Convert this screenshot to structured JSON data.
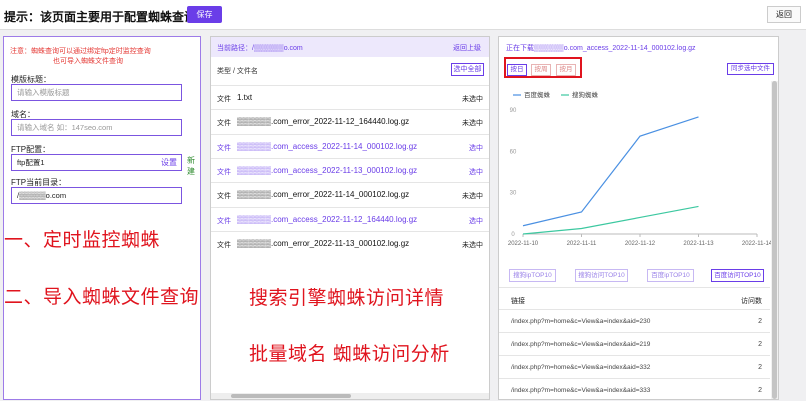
{
  "header": {
    "title": "提示：该页面主要用于配置蜘蛛查询",
    "save_label": "保存",
    "back_label": "返回"
  },
  "left": {
    "note_line1": "注意：蜘蛛查询可以通过绑定ftp定时监控查询",
    "note_line2": "也可导入蜘蛛文件查询",
    "template_label": "模版标题：",
    "template_placeholder": "请输入模版标题",
    "domain_label": "域名：",
    "domain_placeholder": "请输入域名 如：147seo.com",
    "ftp_label": "FTP配置：",
    "ftp_value": "ftp配置1",
    "ftp_set": "设置",
    "ftp_new": "新建",
    "dir_label": "FTP当前目录：",
    "dir_value": "/▒▒▒▒▒o.com"
  },
  "overlay": {
    "t1": "一、定时监控蜘蛛",
    "t2": "二、导入蜘蛛文件查询",
    "t3": "搜索引擎蜘蛛访问详情",
    "t4": "批量域名  蜘蛛访问分析"
  },
  "middle": {
    "path_label": "当前路径：/▒▒▒▒▒▒o.com",
    "up_label": "返回上级",
    "type_header": "类型 / 文件名",
    "select_all": "选中全部",
    "files": [
      {
        "type": "文件",
        "name": "1.txt",
        "status": "未选中",
        "selected": false
      },
      {
        "type": "文件",
        "name": "▒▒▒▒▒▒.com_error_2022-11-12_164440.log.gz",
        "status": "未选中",
        "selected": false
      },
      {
        "type": "文件",
        "name": "▒▒▒▒▒▒.com_access_2022-11-14_000102.log.gz",
        "status": "选中",
        "selected": true
      },
      {
        "type": "文件",
        "name": "▒▒▒▒▒▒.com_access_2022-11-13_000102.log.gz",
        "status": "选中",
        "selected": true
      },
      {
        "type": "文件",
        "name": "▒▒▒▒▒▒.com_error_2022-11-14_000102.log.gz",
        "status": "未选中",
        "selected": false
      },
      {
        "type": "文件",
        "name": "▒▒▒▒▒▒.com_access_2022-11-12_164440.log.gz",
        "status": "选中",
        "selected": true
      },
      {
        "type": "文件",
        "name": "▒▒▒▒▒▒.com_error_2022-11-13_000102.log.gz",
        "status": "未选中",
        "selected": false
      }
    ]
  },
  "right": {
    "downloading": "正在下载▒▒▒▒▒▒o.com_access_2022-11-14_000102.log.gz",
    "period_buttons": [
      "按日",
      "按周",
      "按月"
    ],
    "sync_label": "同步选中文件",
    "top_buttons": [
      "搜狗ipTOP10",
      "搜狗访问TOP10",
      "百度ipTOP10",
      "百度访问TOP10"
    ],
    "list_header_link": "链接",
    "list_header_count": "访问数",
    "rows": [
      {
        "url": "/index.php?m=home&c=View&a=index&aid=230",
        "count": "2"
      },
      {
        "url": "/index.php?m=home&c=View&a=index&aid=219",
        "count": "2"
      },
      {
        "url": "/index.php?m=home&c=View&a=index&aid=332",
        "count": "2"
      },
      {
        "url": "/index.php?m=home&c=View&a=index&aid=333",
        "count": "2"
      }
    ],
    "colors": {
      "baidu": "#4a90e2",
      "sogou": "#3cc8a0"
    }
  },
  "chart_data": {
    "type": "line",
    "x": [
      "2022-11-10",
      "2022-11-11",
      "2022-11-12",
      "2022-11-13",
      "2022-11-14"
    ],
    "series": [
      {
        "name": "百度蜘蛛",
        "values": [
          6,
          16,
          71,
          85,
          null
        ]
      },
      {
        "name": "搜狗蜘蛛",
        "values": [
          0,
          4,
          12,
          20,
          null
        ]
      }
    ],
    "ylim": [
      0,
      90
    ],
    "yticks": [
      "0",
      "30",
      "60",
      "90"
    ],
    "legend": "top-left",
    "grid": false
  }
}
